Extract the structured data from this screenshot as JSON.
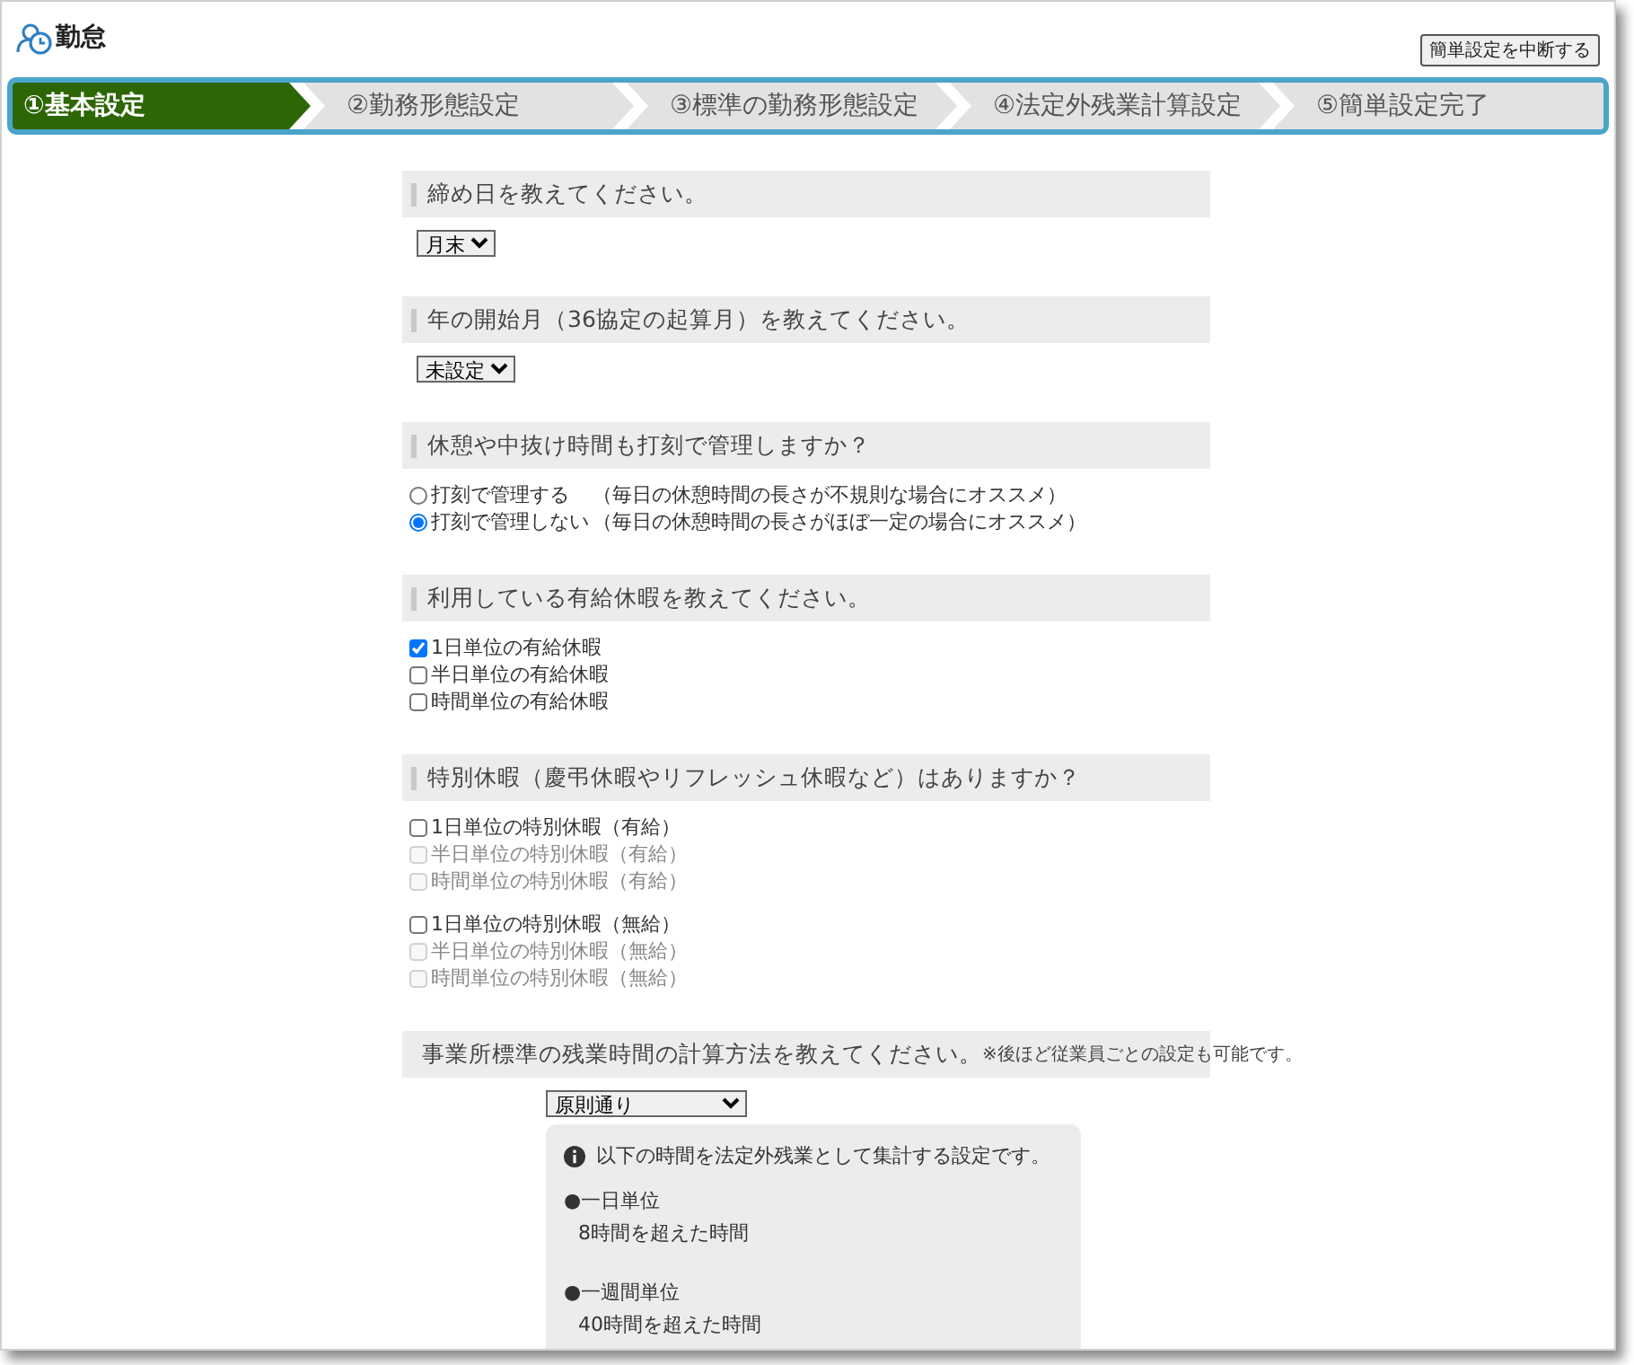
{
  "app": {
    "title": "勤怠",
    "stop_button": "簡単設定を中断する"
  },
  "steps": [
    {
      "label": "①基本設定",
      "selected": true
    },
    {
      "label": "②勤務形態設定",
      "selected": false
    },
    {
      "label": "③標準の勤務形態設定",
      "selected": false
    },
    {
      "label": "④法定外残業計算設定",
      "selected": false
    },
    {
      "label": "⑤簡単設定完了",
      "selected": false
    }
  ],
  "sections": [
    {
      "kind": "select",
      "heading": "締め日を教えてください。",
      "value": "月末"
    },
    {
      "kind": "select",
      "heading": "年の開始月（36協定の起算月）を教えてください。",
      "value": "未設定"
    },
    {
      "kind": "radio",
      "heading": "休憩や中抜け時間も打刻で管理しますか？",
      "options": [
        {
          "label": "打刻で管理する",
          "hint": "（毎日の休憩時間の長さが不規則な場合にオススメ）",
          "selected": false
        },
        {
          "label": "打刻で管理しない",
          "hint": "（毎日の休憩時間の長さがほぼ一定の場合にオススメ）",
          "selected": true
        }
      ]
    },
    {
      "kind": "checkbox",
      "heading": "利用している有給休暇を教えてください。",
      "groups": [
        [
          {
            "label": "1日単位の有給休暇",
            "checked": true,
            "disabled": false
          },
          {
            "label": "半日単位の有給休暇",
            "checked": false,
            "disabled": false
          },
          {
            "label": "時間単位の有給休暇",
            "checked": false,
            "disabled": false
          }
        ]
      ]
    },
    {
      "kind": "checkbox",
      "heading": "特別休暇（慶弔休暇やリフレッシュ休暇など）はありますか？",
      "groups": [
        [
          {
            "label": "1日単位の特別休暇（有給）",
            "checked": false,
            "disabled": false
          },
          {
            "label": "半日単位の特別休暇（有給）",
            "checked": false,
            "disabled": true
          },
          {
            "label": "時間単位の特別休暇（有給）",
            "checked": false,
            "disabled": true
          }
        ],
        [
          {
            "label": "1日単位の特別休暇（無給）",
            "checked": false,
            "disabled": false
          },
          {
            "label": "半日単位の特別休暇（無給）",
            "checked": false,
            "disabled": true
          },
          {
            "label": "時間単位の特別休暇（無給）",
            "checked": false,
            "disabled": true
          }
        ]
      ]
    },
    {
      "kind": "method",
      "heading": "事業所標準の残業時間の計算方法を教えてください。",
      "note": "※後ほど従業員ごとの設定も可能です。",
      "value": "原則通り",
      "info": {
        "intro": "以下の時間を法定外残業として集計する設定です。",
        "items": [
          {
            "title": "●一日単位",
            "detail": "8時間を超えた時間"
          },
          {
            "title": "●一週間単位",
            "detail": "40時間を超えた時間"
          }
        ]
      }
    }
  ]
}
